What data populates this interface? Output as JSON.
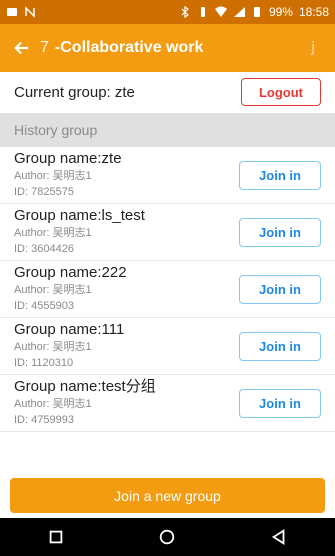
{
  "status_bar": {
    "time": "18:58",
    "battery": "99%",
    "icons": [
      "image-icon",
      "n-icon",
      "bluetooth-icon",
      "vibrate-icon",
      "wifi-icon",
      "signal-icon",
      "battery-icon"
    ]
  },
  "app_bar": {
    "title_prefix": "7",
    "title": "-Collaborative work",
    "trailing_char": "j"
  },
  "current_group": {
    "text": "Current group: zte",
    "logout_label": "Logout"
  },
  "history": {
    "header": "History group",
    "items": [
      {
        "name": "Group name:zte",
        "author": "Author: 吴明志1",
        "id": "ID: 7825575",
        "button": "Join in"
      },
      {
        "name": "Group name:ls_test",
        "author": "Author: 吴明志1",
        "id": "ID: 3604426",
        "button": "Join in"
      },
      {
        "name": "Group name:222",
        "author": "Author: 吴明志1",
        "id": "ID: 4555903",
        "button": "Join in"
      },
      {
        "name": "Group name:111",
        "author": "Author: 吴明志1",
        "id": "ID: 1120310",
        "button": "Join in"
      },
      {
        "name": "Group name:test分组",
        "author": "Author: 吴明志1",
        "id": "ID: 4759993",
        "button": "Join in"
      }
    ]
  },
  "new_group_button": "Join a new group",
  "colors": {
    "accent": "#f39c12",
    "status_bar": "#cf6f00",
    "logout": "#e53935",
    "join": "#1e88e5"
  }
}
